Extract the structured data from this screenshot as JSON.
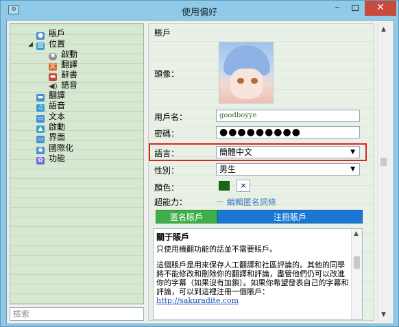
{
  "window": {
    "title": "使用偏好",
    "app_icon": "settings-icon"
  },
  "titlebar": {
    "minimize": "–",
    "close": "✕"
  },
  "tree": {
    "items": [
      {
        "label": "賬戶",
        "icon": "user-icon"
      },
      {
        "label": "位置",
        "icon": "folder-icon"
      },
      {
        "label": "啟動",
        "icon": "gear-icon"
      },
      {
        "label": "翻譯",
        "icon": "translate-icon"
      },
      {
        "label": "辭書",
        "icon": "dictionary-icon"
      },
      {
        "label": "語音",
        "icon": "speaker-icon"
      },
      {
        "label": "翻譯",
        "icon": "translate-icon"
      },
      {
        "label": "語音",
        "icon": "music-icon"
      },
      {
        "label": "文本",
        "icon": "text-icon"
      },
      {
        "label": "啟動",
        "icon": "launch-icon"
      },
      {
        "label": "界面",
        "icon": "window-icon"
      },
      {
        "label": "國際化",
        "icon": "globe-icon"
      },
      {
        "label": "功能",
        "icon": "feature-icon"
      }
    ],
    "search_placeholder": "檢索"
  },
  "account": {
    "section_title": "賬戶",
    "avatar_label": "頭像：",
    "username_label": "用戶名：",
    "username_value": "goodboyye",
    "password_label": "密碼：",
    "password_value": "●●●●●●●●●",
    "language_label": "語言：",
    "language_value": "簡體中文",
    "gender_label": "性別：",
    "gender_value": "男生",
    "color_label": "顏色：",
    "color_value": "#0e6c0e",
    "color_clear": "×",
    "ability_label": "超能力：",
    "ability_link": "－ 編輯匿名詞條",
    "anonymous_button": "匿名賬戶",
    "register_button": "注冊賬戶"
  },
  "about": {
    "title": "關于賬戶",
    "line1": "只使用機翻功能的話並不需要賬戶。",
    "line2": "這個賬戶是用來保存人工翻譯和社區評論的。其他的同學將不能修改和刪除你的翻譯和評論，盡管他們仍可以改進你的字幕（如果沒有加鎖）。如果你希望發表自己的字幕和評論，可以到這裡注冊一個賬戶：",
    "url": "http://sakuradite.com"
  },
  "colors": {
    "highlight": "#dd2222",
    "anon_button": "#3fae49",
    "register_button": "#1a78d4"
  }
}
